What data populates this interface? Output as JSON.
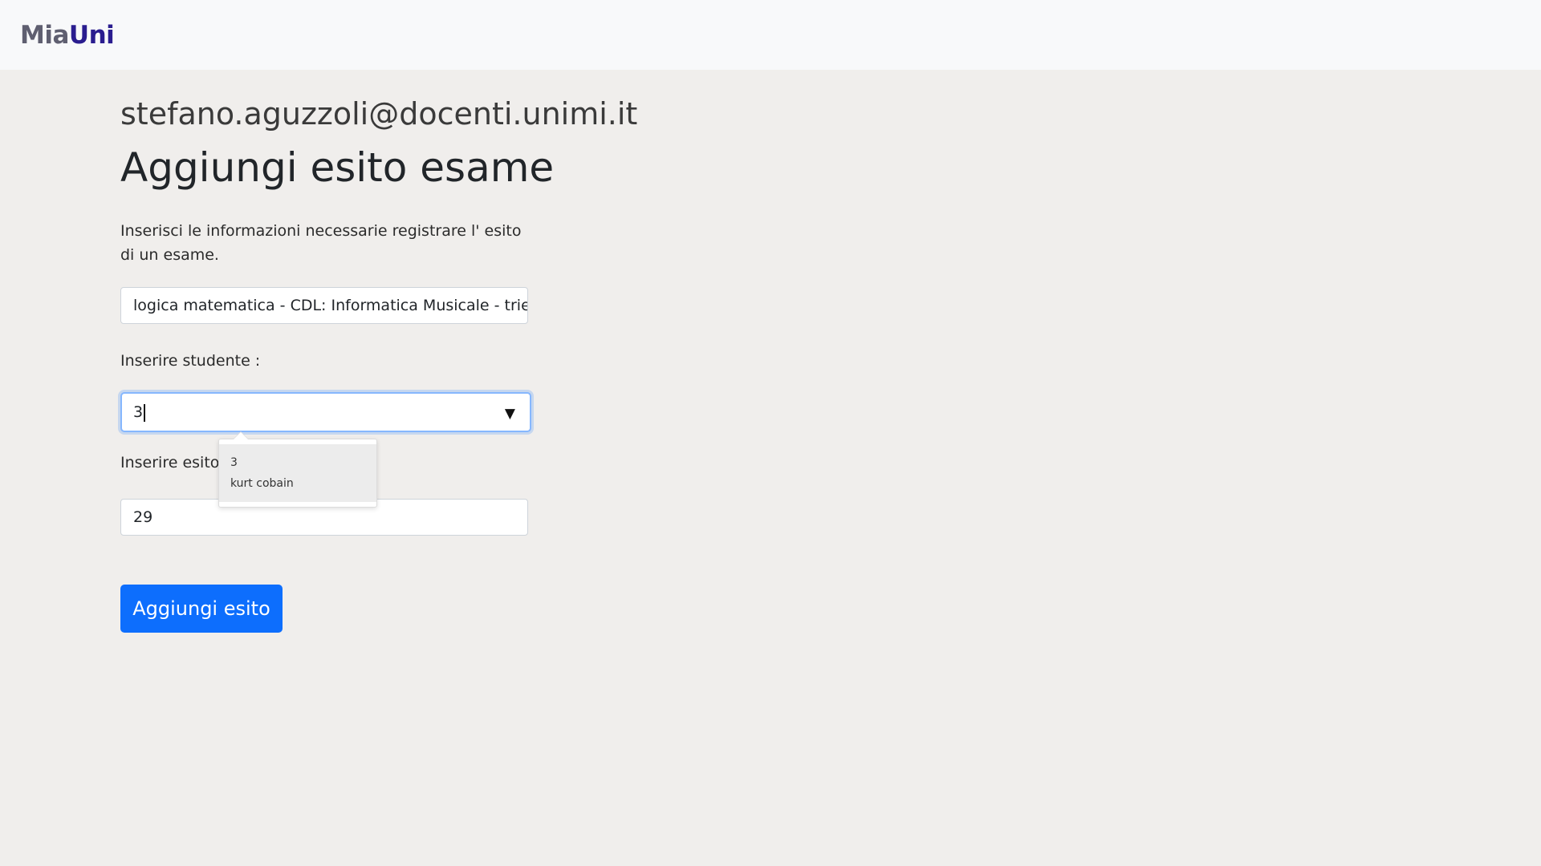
{
  "navbar": {
    "brand_part1": "Mia",
    "brand_part2": "Uni"
  },
  "header": {
    "user_email": "stefano.aguzzoli@docenti.unimi.it",
    "title": "Aggiungi esito esame"
  },
  "form": {
    "intro": "Inserisci le informazioni necessarie registrare l' esito di un esame.",
    "exam_value": "logica matematica - CDL: Informatica Musicale - triennale",
    "student_label": "Inserire studente :",
    "student_value": "3",
    "student_arrow": "▼",
    "grade_label": "Inserire esito esame :",
    "grade_value": "29",
    "submit_label": "Aggiungi esito"
  },
  "dropdown": {
    "items": [
      {
        "id": "3",
        "name": "kurt cobain"
      }
    ]
  },
  "colors": {
    "primary": "#0d6efd",
    "brand_dark": "#2a1d8f",
    "brand_gray": "#5f5f70",
    "background": "#f0eeec",
    "navbar": "#f8f9fa"
  }
}
